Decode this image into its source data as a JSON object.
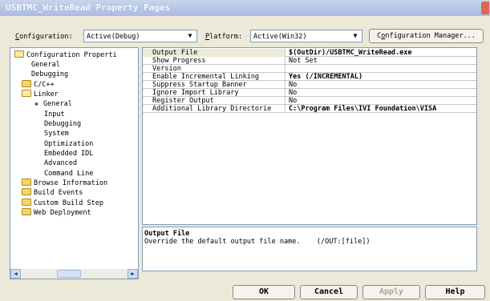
{
  "window": {
    "title": "USBTMC_WriteRead Property Pages"
  },
  "toolbar": {
    "configuration_label_u": "C",
    "configuration_label_rest": "onfiguration:",
    "configuration_value": "Active(Debug)",
    "platform_label_u": "P",
    "platform_label_rest": "latform:",
    "platform_value": "Active(Win32)",
    "config_manager_pre": "C",
    "config_manager_u": "o",
    "config_manager_rest": "nfiguration Manager..."
  },
  "tree": {
    "items": [
      {
        "label": "Configuration Properti",
        "kind": "folder-open"
      },
      {
        "label": "General",
        "kind": "leaf"
      },
      {
        "label": "Debugging",
        "kind": "leaf"
      },
      {
        "label": "C/C++",
        "kind": "folder"
      },
      {
        "label": "Linker",
        "kind": "folder-open"
      },
      {
        "label": "General",
        "kind": "bullet"
      },
      {
        "label": "Input",
        "kind": "leaf"
      },
      {
        "label": "Debugging",
        "kind": "leaf"
      },
      {
        "label": "System",
        "kind": "leaf"
      },
      {
        "label": "Optimization",
        "kind": "leaf"
      },
      {
        "label": "Embedded IDL",
        "kind": "leaf"
      },
      {
        "label": "Advanced",
        "kind": "leaf"
      },
      {
        "label": "Command Line",
        "kind": "leaf"
      },
      {
        "label": "Browse Information",
        "kind": "folder"
      },
      {
        "label": "Build Events",
        "kind": "folder"
      },
      {
        "label": "Custom Build Step",
        "kind": "folder"
      },
      {
        "label": "Web Deployment",
        "kind": "folder"
      }
    ]
  },
  "grid": {
    "rows": [
      {
        "name": "Output File",
        "value": "$(OutDir)/USBTMC_WriteRead.exe",
        "bold": true
      },
      {
        "name": "Show Progress",
        "value": "Not Set",
        "bold": false
      },
      {
        "name": "Version",
        "value": "",
        "bold": false
      },
      {
        "name": "Enable Incremental Linking",
        "value": "Yes (/INCREMENTAL)",
        "bold": true
      },
      {
        "name": "Suppress Startup Banner",
        "value": "No",
        "bold": false
      },
      {
        "name": "Ignore Import Library",
        "value": "No",
        "bold": false
      },
      {
        "name": "Register Output",
        "value": "No",
        "bold": false
      },
      {
        "name": "Additional Library Directorie",
        "value": "C:\\Program Files\\IVI Foundation\\VISA",
        "bold": true
      }
    ]
  },
  "description": {
    "title": "Output File",
    "text": "Override the default output file name.    (/OUT:[file])"
  },
  "buttons": {
    "ok": "OK",
    "cancel": "Cancel",
    "apply": "Apply",
    "help": "Help"
  },
  "icons": {
    "close": "close-icon",
    "dropdown": "chevron-down-icon",
    "folder": "folder-icon",
    "scroll_left": "arrow-left-icon",
    "scroll_right": "arrow-right-icon"
  },
  "colors": {
    "titlebar": "#a9bce2",
    "dialog": "#ece9d8",
    "folder": "#f3d66b",
    "close": "#d9694c"
  }
}
